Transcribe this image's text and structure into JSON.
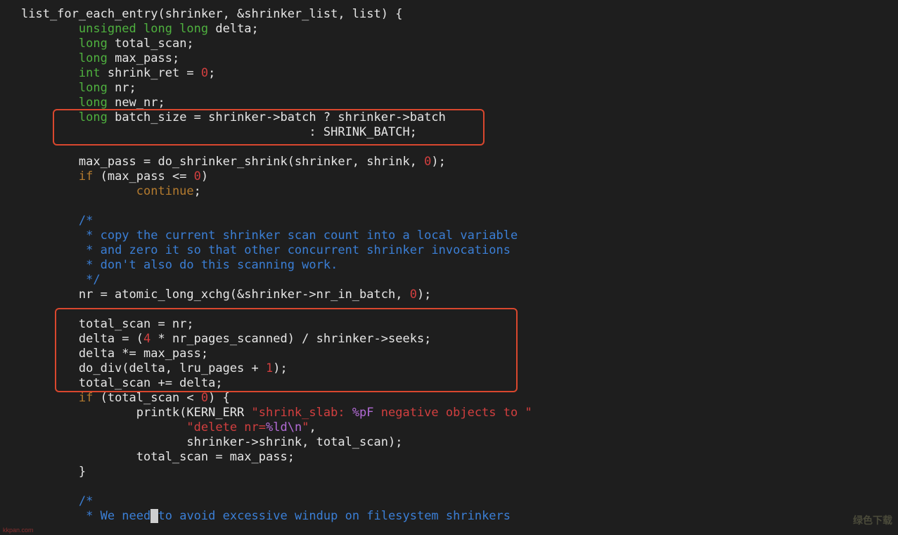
{
  "editor": {
    "lines": [
      [
        {
          "t": "plain",
          "v": "list_for_each_entry(shrinker, &shrinker_list, list) {"
        }
      ],
      [
        {
          "t": "plain",
          "v": "        "
        },
        {
          "t": "type",
          "v": "unsigned long long"
        },
        {
          "t": "plain",
          "v": " delta;"
        }
      ],
      [
        {
          "t": "plain",
          "v": "        "
        },
        {
          "t": "type",
          "v": "long"
        },
        {
          "t": "plain",
          "v": " total_scan;"
        }
      ],
      [
        {
          "t": "plain",
          "v": "        "
        },
        {
          "t": "type",
          "v": "long"
        },
        {
          "t": "plain",
          "v": " max_pass;"
        }
      ],
      [
        {
          "t": "plain",
          "v": "        "
        },
        {
          "t": "type",
          "v": "int"
        },
        {
          "t": "plain",
          "v": " shrink_ret = "
        },
        {
          "t": "num",
          "v": "0"
        },
        {
          "t": "plain",
          "v": ";"
        }
      ],
      [
        {
          "t": "plain",
          "v": "        "
        },
        {
          "t": "type",
          "v": "long"
        },
        {
          "t": "plain",
          "v": " nr;"
        }
      ],
      [
        {
          "t": "plain",
          "v": "        "
        },
        {
          "t": "type",
          "v": "long"
        },
        {
          "t": "plain",
          "v": " new_nr;"
        }
      ],
      [
        {
          "t": "plain",
          "v": "        "
        },
        {
          "t": "type",
          "v": "long"
        },
        {
          "t": "plain",
          "v": " batch_size = shrinker->batch ? shrinker->batch"
        }
      ],
      [
        {
          "t": "plain",
          "v": "                                        : SHRINK_BATCH;"
        }
      ],
      [
        {
          "t": "plain",
          "v": ""
        }
      ],
      [
        {
          "t": "plain",
          "v": "        max_pass = do_shrinker_shrink(shrinker, shrink, "
        },
        {
          "t": "num",
          "v": "0"
        },
        {
          "t": "plain",
          "v": ");"
        }
      ],
      [
        {
          "t": "plain",
          "v": "        "
        },
        {
          "t": "kw",
          "v": "if"
        },
        {
          "t": "plain",
          "v": " (max_pass <= "
        },
        {
          "t": "num",
          "v": "0"
        },
        {
          "t": "plain",
          "v": ")"
        }
      ],
      [
        {
          "t": "plain",
          "v": "                "
        },
        {
          "t": "kw",
          "v": "continue"
        },
        {
          "t": "plain",
          "v": ";"
        }
      ],
      [
        {
          "t": "plain",
          "v": ""
        }
      ],
      [
        {
          "t": "plain",
          "v": "        "
        },
        {
          "t": "comment",
          "v": "/*"
        }
      ],
      [
        {
          "t": "plain",
          "v": "         "
        },
        {
          "t": "comment",
          "v": "* copy the current shrinker scan count into a local variable"
        }
      ],
      [
        {
          "t": "plain",
          "v": "         "
        },
        {
          "t": "comment",
          "v": "* and zero it so that other concurrent shrinker invocations"
        }
      ],
      [
        {
          "t": "plain",
          "v": "         "
        },
        {
          "t": "comment",
          "v": "* don't also do this scanning work."
        }
      ],
      [
        {
          "t": "plain",
          "v": "         "
        },
        {
          "t": "comment",
          "v": "*/"
        }
      ],
      [
        {
          "t": "plain",
          "v": "        nr = atomic_long_xchg(&shrinker->nr_in_batch, "
        },
        {
          "t": "num",
          "v": "0"
        },
        {
          "t": "plain",
          "v": ");"
        }
      ],
      [
        {
          "t": "plain",
          "v": ""
        }
      ],
      [
        {
          "t": "plain",
          "v": "        total_scan = nr;"
        }
      ],
      [
        {
          "t": "plain",
          "v": "        delta = ("
        },
        {
          "t": "num",
          "v": "4"
        },
        {
          "t": "plain",
          "v": " * nr_pages_scanned) / shrinker->seeks;"
        }
      ],
      [
        {
          "t": "plain",
          "v": "        delta *= max_pass;"
        }
      ],
      [
        {
          "t": "plain",
          "v": "        do_div(delta, lru_pages + "
        },
        {
          "t": "num",
          "v": "1"
        },
        {
          "t": "plain",
          "v": ");"
        }
      ],
      [
        {
          "t": "plain",
          "v": "        total_scan += delta;"
        }
      ],
      [
        {
          "t": "plain",
          "v": "        "
        },
        {
          "t": "kw",
          "v": "if"
        },
        {
          "t": "plain",
          "v": " (total_scan < "
        },
        {
          "t": "num",
          "v": "0"
        },
        {
          "t": "plain",
          "v": ") {"
        }
      ],
      [
        {
          "t": "plain",
          "v": "                printk(KERN_ERR "
        },
        {
          "t": "string",
          "v": "\"shrink_slab: "
        },
        {
          "t": "fmt",
          "v": "%pF"
        },
        {
          "t": "string",
          "v": " negative objects to \""
        }
      ],
      [
        {
          "t": "plain",
          "v": "                       "
        },
        {
          "t": "string",
          "v": "\"delete nr="
        },
        {
          "t": "fmt",
          "v": "%ld\\n"
        },
        {
          "t": "string",
          "v": "\""
        },
        {
          "t": "plain",
          "v": ","
        }
      ],
      [
        {
          "t": "plain",
          "v": "                       shrinker->shrink, total_scan);"
        }
      ],
      [
        {
          "t": "plain",
          "v": "                total_scan = max_pass;"
        }
      ],
      [
        {
          "t": "plain",
          "v": "        }"
        }
      ],
      [
        {
          "t": "plain",
          "v": ""
        }
      ],
      [
        {
          "t": "plain",
          "v": "        "
        },
        {
          "t": "comment",
          "v": "/*"
        }
      ],
      [
        {
          "t": "plain",
          "v": "         "
        },
        {
          "t": "comment",
          "v": "* We need"
        },
        {
          "t": "cursor",
          "v": " "
        },
        {
          "t": "comment",
          "v": "to avoid excessive windup on filesystem shrinkers"
        }
      ]
    ]
  },
  "watermarks": {
    "left": "kkpan.com",
    "right": "绿色下载"
  },
  "colors": {
    "background": "#1e1e1e",
    "text": "#e6e6e6",
    "type": "#4fb13f",
    "number": "#d23f3f",
    "keyword": "#b47b2f",
    "comment": "#3b7fd6",
    "string": "#d23f3f",
    "format": "#b36bd6",
    "highlight_box": "#d9472e"
  }
}
